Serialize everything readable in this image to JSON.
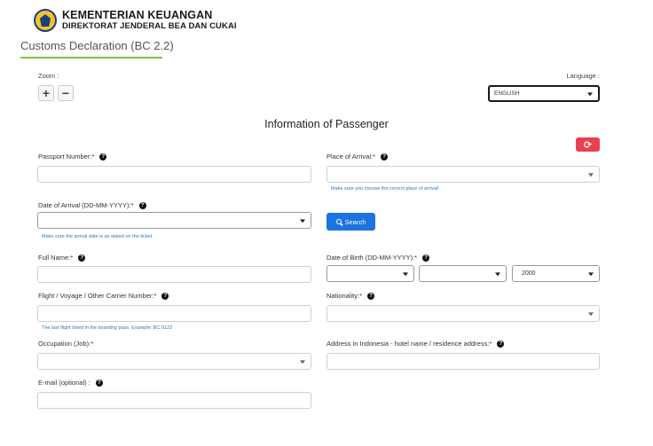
{
  "header": {
    "org_name": "KEMENTERIAN KEUANGAN",
    "sub_org": "DIREKTORAT JENDERAL BEA DAN CUKAI",
    "logo_icon": "ministry-logo-icon"
  },
  "page": {
    "title": "Customs Declaration (BC 2.2)",
    "section_title": "Information of Passenger",
    "accent_color": "#7cc242"
  },
  "zoom": {
    "label": "Zoom :",
    "plus": "+",
    "minus": "−"
  },
  "language": {
    "label": "Language :",
    "selected": "ENGLISH"
  },
  "refresh": {
    "icon": "refresh-icon",
    "glyph": "⟳",
    "color": "#e9414f"
  },
  "form": {
    "passport_label": "Passport Number:*",
    "place_arrival_label": "Place of Arrival:*",
    "place_arrival_hint": "Make sure you choose the correct place of arrival!",
    "date_arrival_label": "Date of Arrival (DD-MM-YYYY):*",
    "date_arrival_hint": "Make sure the arrival date is as stated on the ticket.",
    "search_label": "Search",
    "full_name_label": "Full Name:*",
    "dob_label": "Date of Birth (DD-MM-YYYY):*",
    "dob_year": "2000",
    "flight_label": "Flight / Voyage / Other Carrier Number:*",
    "flight_hint": "The last flight listed in the boarding pass. Example: BC 0123",
    "nationality_label": "Nationality:*",
    "occupation_label": "Occupation (Job):*",
    "address_label": "Address in Indonesia - hotel name / residence address:*",
    "email_label": "E-mail (optional) :",
    "help_glyph": "?"
  }
}
